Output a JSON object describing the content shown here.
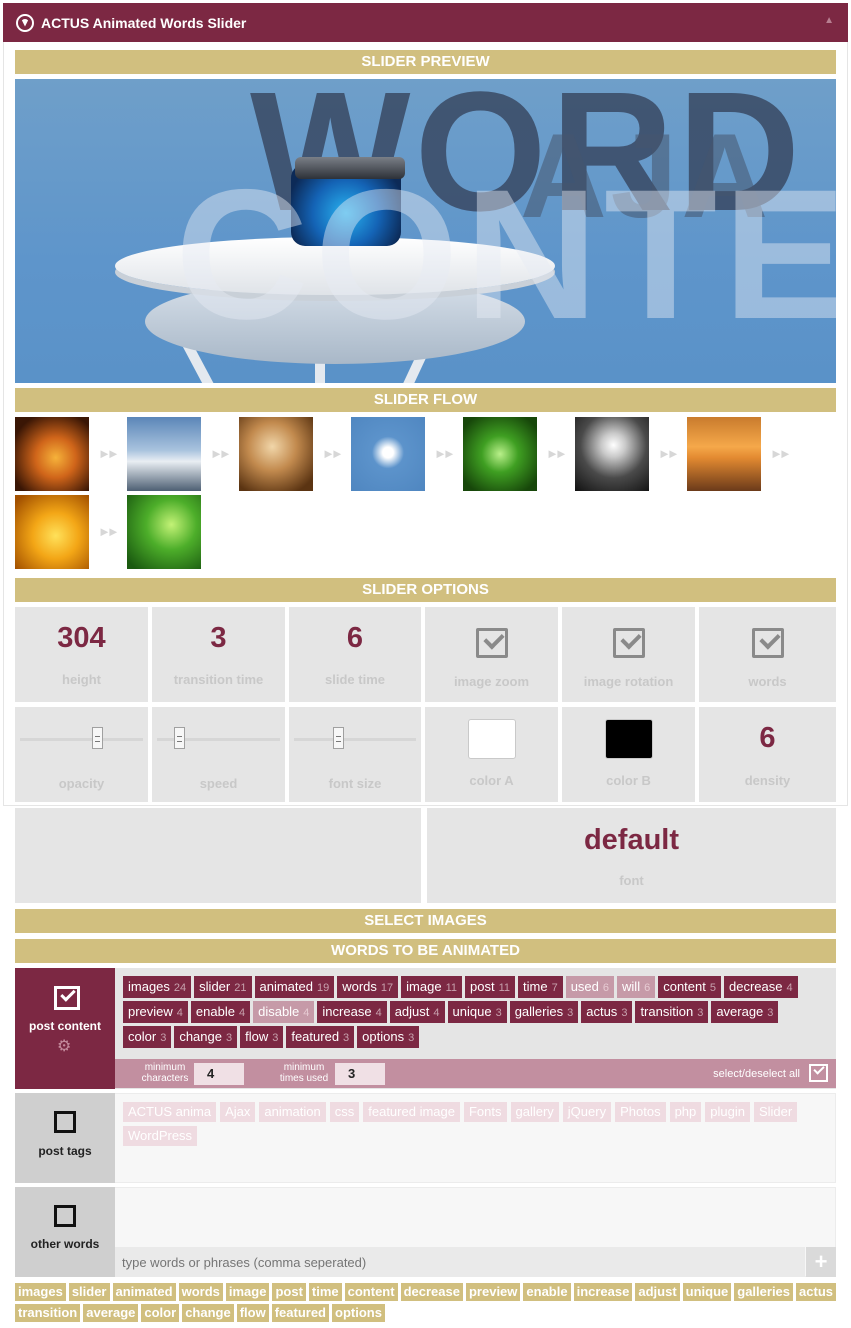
{
  "window": {
    "title": "ACTUS Animated Words Slider"
  },
  "sections": {
    "preview": "SLIDER PREVIEW",
    "flow": "SLIDER FLOW",
    "options": "SLIDER OPTIONS",
    "select_images": "SELECT IMAGES",
    "words": "WORDS TO BE ANIMATED"
  },
  "preview_words": [
    "WORD",
    "CONTEN",
    "AJA"
  ],
  "options": {
    "height": {
      "value": "304",
      "label": "height"
    },
    "transition_time": {
      "value": "3",
      "label": "transition time"
    },
    "slide_time": {
      "value": "6",
      "label": "slide time"
    },
    "image_zoom": {
      "label": "image zoom",
      "checked": true
    },
    "image_rotation": {
      "label": "image rotation",
      "checked": true
    },
    "words": {
      "label": "words",
      "checked": true
    },
    "opacity": {
      "label": "opacity",
      "level": 0.6
    },
    "speed": {
      "label": "speed",
      "level": 0.15
    },
    "font_size": {
      "label": "font size",
      "level": 0.35
    },
    "color_a": {
      "label": "color A",
      "color": "#ffffff"
    },
    "color_b": {
      "label": "color B",
      "color": "#000000"
    },
    "density": {
      "value": "6",
      "label": "density"
    },
    "font": {
      "value": "default",
      "label": "font"
    }
  },
  "post_content": {
    "label": "post content",
    "checked": true,
    "tags": [
      {
        "w": "images",
        "n": "24",
        "dim": false
      },
      {
        "w": "slider",
        "n": "21",
        "dim": false
      },
      {
        "w": "animated",
        "n": "19",
        "dim": false
      },
      {
        "w": "words",
        "n": "17",
        "dim": false
      },
      {
        "w": "image",
        "n": "11",
        "dim": false
      },
      {
        "w": "post",
        "n": "11",
        "dim": false
      },
      {
        "w": "time",
        "n": "7",
        "dim": false
      },
      {
        "w": "used",
        "n": "6",
        "dim": true
      },
      {
        "w": "will",
        "n": "6",
        "dim": true
      },
      {
        "w": "content",
        "n": "5",
        "dim": false
      },
      {
        "w": "decrease",
        "n": "4",
        "dim": false
      },
      {
        "w": "preview",
        "n": "4",
        "dim": false
      },
      {
        "w": "enable",
        "n": "4",
        "dim": false
      },
      {
        "w": "disable",
        "n": "4",
        "dim": true
      },
      {
        "w": "increase",
        "n": "4",
        "dim": false
      },
      {
        "w": "adjust",
        "n": "4",
        "dim": false
      },
      {
        "w": "unique",
        "n": "3",
        "dim": false
      },
      {
        "w": "galleries",
        "n": "3",
        "dim": false
      },
      {
        "w": "actus",
        "n": "3",
        "dim": false
      },
      {
        "w": "transition",
        "n": "3",
        "dim": false
      },
      {
        "w": "average",
        "n": "3",
        "dim": false
      },
      {
        "w": "color",
        "n": "3",
        "dim": false
      },
      {
        "w": "change",
        "n": "3",
        "dim": false
      },
      {
        "w": "flow",
        "n": "3",
        "dim": false
      },
      {
        "w": "featured",
        "n": "3",
        "dim": false
      },
      {
        "w": "options",
        "n": "3",
        "dim": false
      }
    ],
    "min_chars_label": "minimum characters",
    "min_chars": "4",
    "min_times_label": "minimum times used",
    "min_times": "3",
    "select_all": "select/deselect all"
  },
  "post_tags": {
    "label": "post tags",
    "checked": false,
    "tags": [
      "ACTUS anima",
      "Ajax",
      "animation",
      "css",
      "featured image",
      "Fonts",
      "gallery",
      "jQuery",
      "Photos",
      "php",
      "plugin",
      "Slider",
      "WordPress"
    ]
  },
  "other_words": {
    "label": "other words",
    "checked": false,
    "placeholder": "type words or phrases (comma seperated)",
    "add": "+"
  },
  "bottom_tags": [
    "images",
    "slider",
    "animated",
    "words",
    "image",
    "post",
    "time",
    "content",
    "decrease",
    "preview",
    "enable",
    "increase",
    "adjust",
    "unique",
    "galleries",
    "actus",
    "transition",
    "average",
    "color",
    "change",
    "flow",
    "featured",
    "options"
  ],
  "colors": {
    "accent": "#7c2843",
    "gold": "#d1bf7f",
    "panel": "#e5e5e5"
  },
  "flow_thumbs": [
    "tree-sunset",
    "snowy-mountains",
    "woman-violin",
    "blue-jar-stool",
    "green-succulent",
    "light-bulb",
    "orange-sunset",
    "yellow-leaf-drops",
    "green-leaf"
  ]
}
